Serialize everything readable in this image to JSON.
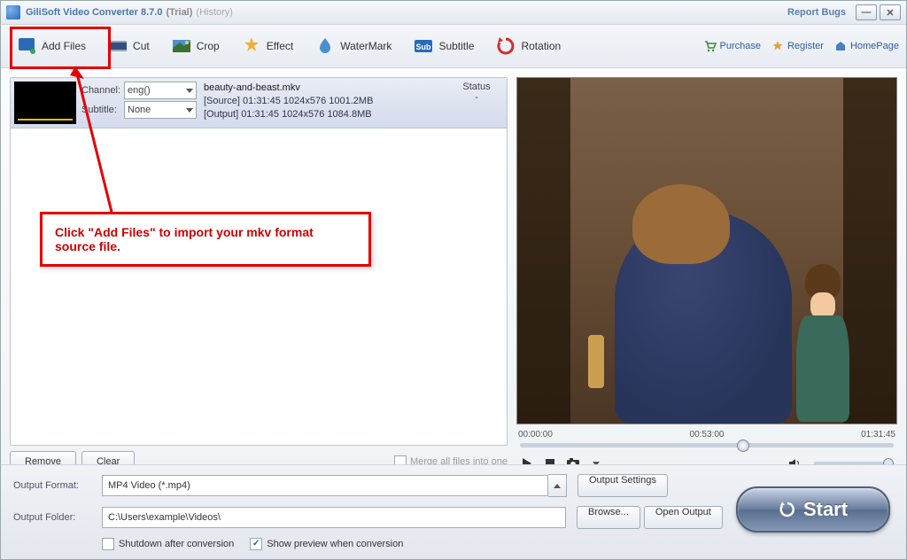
{
  "title": {
    "app": "GiliSoft Video Converter 8.7.0",
    "trial": "(Trial)",
    "history": "(History)",
    "report": "Report Bugs"
  },
  "toolbar": {
    "add": "Add Files",
    "cut": "Cut",
    "crop": "Crop",
    "effect": "Effect",
    "watermark": "WaterMark",
    "subtitle": "Subtitle",
    "rotation": "Rotation"
  },
  "links": {
    "purchase": "Purchase",
    "register": "Register",
    "home": "HomePage"
  },
  "file": {
    "channel_label": "Channel:",
    "channel_value": "eng()",
    "subtitle_label": "Subtitle:",
    "subtitle_value": "None",
    "name": "beauty-and-beast.mkv",
    "source": "[Source]  01:31:45  1024x576  1001.2MB",
    "output": "[Output]  01:31:45  1024x576  1084.8MB",
    "status_label": "Status",
    "status_value": "-"
  },
  "callout": "Click \"Add Files\" to import your mkv format source file.",
  "buttons": {
    "remove": "Remove",
    "clear": "Clear",
    "merge": "Merge all files into one"
  },
  "timeline": {
    "t0": "00:00:00",
    "t1": "00:53:00",
    "t2": "01:31:45",
    "pos": 0.58
  },
  "format": {
    "label": "Output Format:",
    "value": "MP4 Video (*.mp4)",
    "settings": "Output Settings"
  },
  "folder": {
    "label": "Output Folder:",
    "value": "C:\\Users\\example\\Videos\\",
    "browse": "Browse...",
    "open": "Open Output"
  },
  "opts": {
    "shutdown": "Shutdown after conversion",
    "preview": "Show preview when conversion",
    "preview_checked": true
  },
  "start": "Start"
}
